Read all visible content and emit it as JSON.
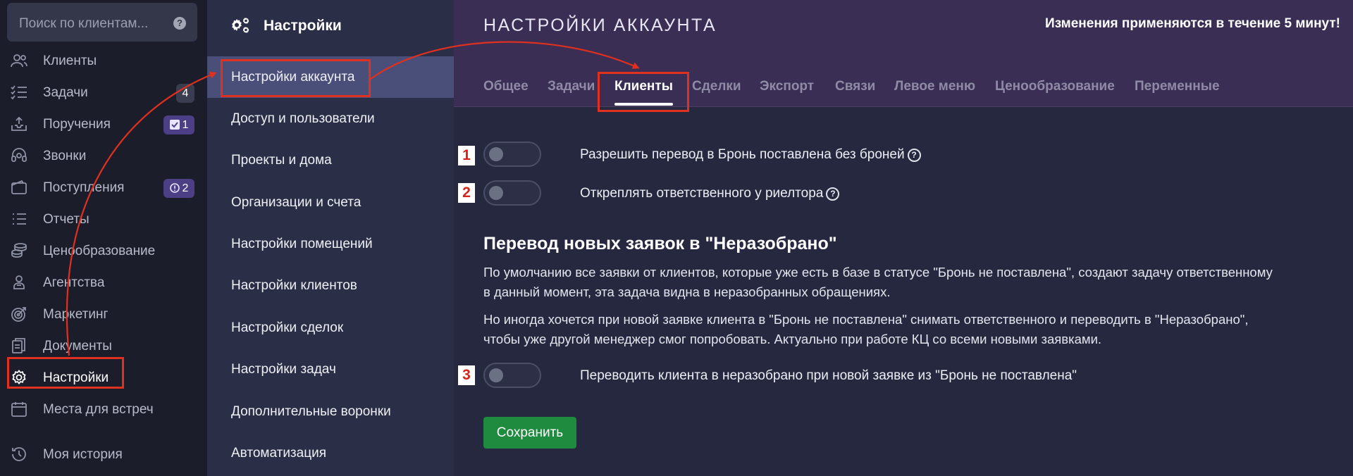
{
  "search": {
    "placeholder": "Поиск по клиентам...",
    "help_icon": "question-circle-icon"
  },
  "leftnav": {
    "items": [
      {
        "label": "Клиенты",
        "icon": "users-icon"
      },
      {
        "label": "Задачи",
        "icon": "checklist-icon",
        "badge": "4"
      },
      {
        "label": "Поручения",
        "icon": "inbox-upload-icon",
        "badge": "1",
        "badge_icon": "checkbox-icon"
      },
      {
        "label": "Звонки",
        "icon": "headset-icon"
      },
      {
        "label": "Поступления",
        "icon": "wallet-icon",
        "badge": "2",
        "badge_icon": "alert-circle-icon"
      },
      {
        "label": "Отчеты",
        "icon": "list-icon"
      },
      {
        "label": "Ценообразование",
        "icon": "coins-icon"
      },
      {
        "label": "Агентства",
        "icon": "agent-icon"
      },
      {
        "label": "Маркетинг",
        "icon": "target-icon"
      },
      {
        "label": "Документы",
        "icon": "documents-icon"
      },
      {
        "label": "Настройки",
        "icon": "gear-icon",
        "active": true
      },
      {
        "label": "Места для встреч",
        "icon": "calendar-icon"
      },
      {
        "label": "Моя история",
        "icon": "history-icon"
      }
    ]
  },
  "settings_menu": {
    "title": "Настройки",
    "items": [
      "Настройки аккаунта",
      "Доступ и пользователи",
      "Проекты и дома",
      "Организации и счета",
      "Настройки помещений",
      "Настройки клиентов",
      "Настройки сделок",
      "Настройки задач",
      "Дополнительные воронки",
      "Автоматизация"
    ],
    "active_index": 0
  },
  "main": {
    "title": "НАСТРОЙКИ АККАУНТА",
    "notice": "Изменения применяются в течение 5 минут!",
    "tabs": [
      "Общее",
      "Задачи",
      "Клиенты",
      "Сделки",
      "Экспорт",
      "Связи",
      "Левое меню",
      "Ценообразование",
      "Переменные"
    ],
    "active_tab": "Клиенты",
    "toggles": [
      {
        "marker": "1",
        "label": "Разрешить перевод в Бронь поставлена без броней",
        "enabled": false,
        "help": true
      },
      {
        "marker": "2",
        "label": "Откреплять ответственного у риелтора",
        "enabled": false,
        "help": true
      },
      {
        "marker": "3",
        "label": "Переводить клиента в неразобрано при новой заявке из \"Бронь не поставлена\"",
        "enabled": false,
        "help": false
      }
    ],
    "section_title": "Перевод новых заявок в \"Неразобрано\"",
    "paragraph_1": "По умолчанию все заявки от клиентов, которые уже есть в базе в статусе \"Бронь не поставлена\", создают задачу ответственному в данный момент, эта задача видна в неразобранных обращениях.",
    "paragraph_2": "Но иногда хочется при новой заявке клиента в \"Бронь не поставлена\" снимать ответственного и переводить в \"Неразобрано\", чтобы уже другой менеджер смог попробовать. Актуально при работе КЦ со всеми новыми заявками.",
    "save_label": "Сохранить"
  },
  "colors": {
    "annotation": "#e0301f",
    "save_button": "#1f8b3f",
    "active_menu": "#4a4f79",
    "topbar": "#3a2e55"
  }
}
